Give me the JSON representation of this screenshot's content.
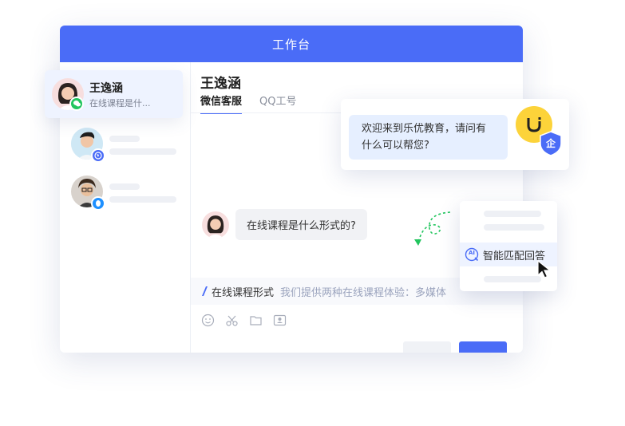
{
  "window": {
    "title": "工作台"
  },
  "sidebar": {
    "active_contact": {
      "name": "王逸涵",
      "preview": "在线课程是什..."
    }
  },
  "chat": {
    "contact_name": "王逸涵",
    "tabs": [
      {
        "label": "微信客服",
        "active": true
      },
      {
        "label": "QQ工号",
        "active": false
      }
    ],
    "incoming_message": "在线课程是什么形式的?"
  },
  "greeting": {
    "text": "欢迎来到乐优教育，请问有什么可以帮您?",
    "badge": "企"
  },
  "quick_reply": {
    "title": "在线课程形式",
    "preview": "我们提供两种在线课程体验：多媒体"
  },
  "ai_menu": {
    "icon_text": "AI",
    "label": "智能匹配回答"
  },
  "colors": {
    "primary": "#4a6cf7",
    "wechat": "#22c55e",
    "qq": "#1e90ff",
    "logo": "#fcd33a"
  }
}
